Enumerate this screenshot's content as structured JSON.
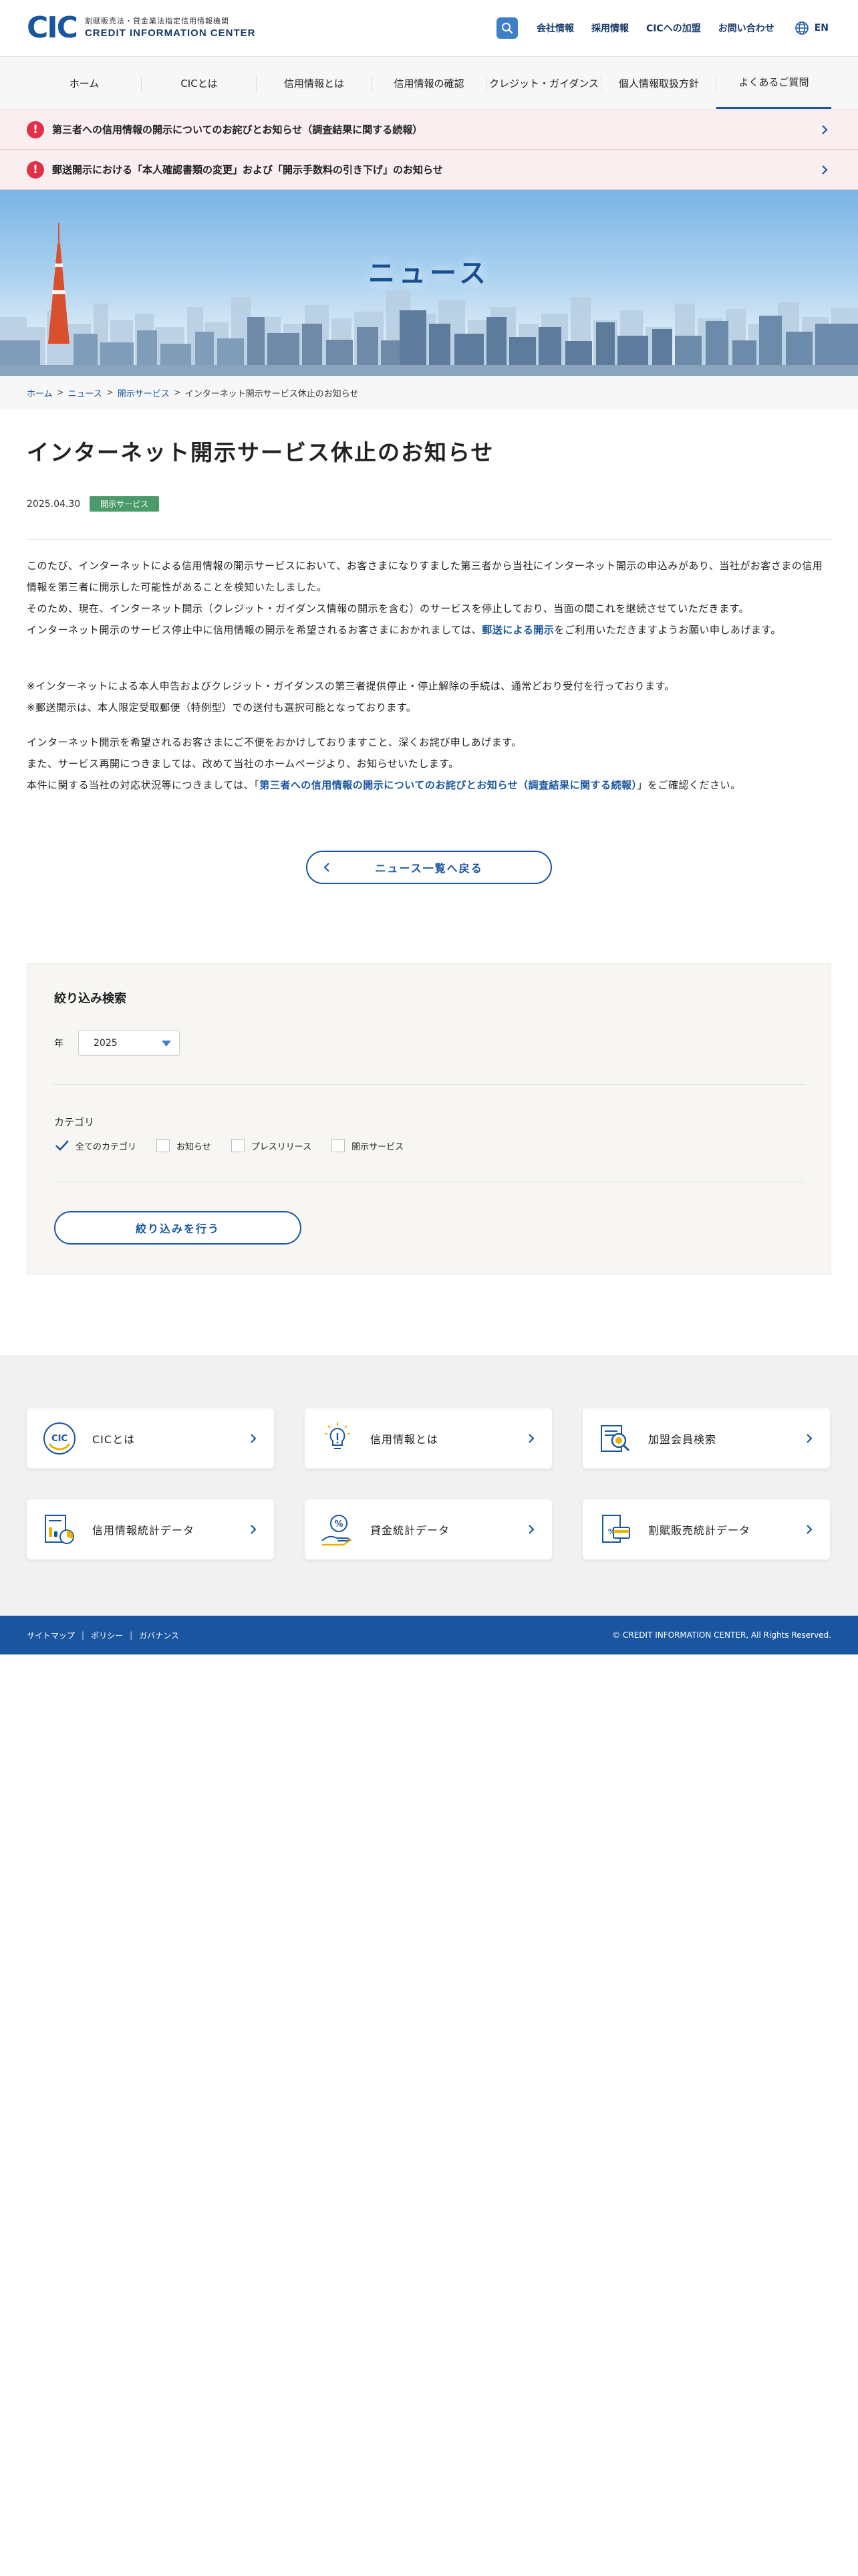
{
  "header": {
    "logo_mark": "CIC",
    "logo_sub": "割賦販売法・貸金業法指定信用情報機関",
    "logo_en": "CREDIT INFORMATION CENTER",
    "util_links": [
      "会社情報",
      "採用情報",
      "CICへの加盟",
      "お問い合わせ"
    ],
    "lang": "EN",
    "accent_color": "#1a56a0"
  },
  "nav": {
    "items": [
      "ホーム",
      "CICとは",
      "信用情報とは",
      "信用情報の確認",
      "クレジット・ガイダンス",
      "個人情報取扱方針",
      "よくあるご質問"
    ]
  },
  "alerts": [
    {
      "text": "第三者への信用情報の開示についてのお詫びとお知らせ（調査結果に関する続報）"
    },
    {
      "text": "郵送開示における「本人確認書類の変更」および「開示手数料の引き下げ」のお知らせ"
    }
  ],
  "hero": {
    "title": "ニュース"
  },
  "breadcrumb": {
    "items": [
      "ホーム",
      "ニュース",
      "開示サービス"
    ],
    "current": "インターネット開示サービス休止のお知らせ"
  },
  "article": {
    "title": "インターネット開示サービス休止のお知らせ",
    "date": "2025.04.30",
    "tag": "開示サービス",
    "p1_l1": "このたび、インターネットによる信用情報の開示サービスにおいて、お客さまになりすました第三者から当社にインターネット開示の申込みがあり、当社がお客さまの信用情報を第三者に開示した可能性があることを検知いたしました。",
    "p1_l2": "そのため、現在、インターネット開示（クレジット・ガイダンス情報の開示を含む）のサービスを停止しており、当面の間これを継続させていただきます。",
    "p1_l3a": "インターネット開示のサービス停止中に信用情報の開示を希望されるお客さまにおかれましては、",
    "p1_link": "郵送による開示",
    "p1_l3b": "をご利用いただきますようお願い申しあげます。",
    "p2_l1": "※インターネットによる本人申告およびクレジット・ガイダンスの第三者提供停止・停止解除の手続は、通常どおり受付を行っております。",
    "p2_l2": "※郵送開示は、本人限定受取郵便（特例型）での送付も選択可能となっております。",
    "p3_l1": "インターネット開示を希望されるお客さまにご不便をおかけしておりますこと、深くお詫び申しあげます。",
    "p3_l2": "また、サービス再開につきましては、改めて当社のホームページより、お知らせいたします。",
    "p3_l3a": "本件に関する当社の対応状況等につきましては、「",
    "p3_link": "第三者への信用情報の開示についてのお詫びとお知らせ（調査結果に関する続報）",
    "p3_l3b": "」をご確認ください。",
    "back_label": "ニュース一覧へ戻る"
  },
  "filter": {
    "title": "絞り込み検索",
    "year_label": "年",
    "year_value": "2025",
    "category_label": "カテゴリ",
    "categories": [
      {
        "label": "全てのカテゴリ",
        "checked": true
      },
      {
        "label": "お知らせ",
        "checked": false
      },
      {
        "label": "プレスリリース",
        "checked": false
      },
      {
        "label": "開示サービス",
        "checked": false
      }
    ],
    "submit_label": "絞り込みを行う"
  },
  "quick_links": [
    {
      "label": "CICとは",
      "icon": "cic-logo-icon"
    },
    {
      "label": "信用情報とは",
      "icon": "lightbulb-icon"
    },
    {
      "label": "加盟会員検索",
      "icon": "member-search-icon"
    },
    {
      "label": "信用情報統計データ",
      "icon": "credit-statistics-icon"
    },
    {
      "label": "貸金統計データ",
      "icon": "loan-statistics-icon"
    },
    {
      "label": "割賦販売統計データ",
      "icon": "installment-statistics-icon"
    }
  ],
  "footer": {
    "links": [
      "サイトマップ",
      "ポリシー",
      "ガバナンス"
    ],
    "copyright": "© CREDIT INFORMATION CENTER, All Rights Reserved."
  }
}
